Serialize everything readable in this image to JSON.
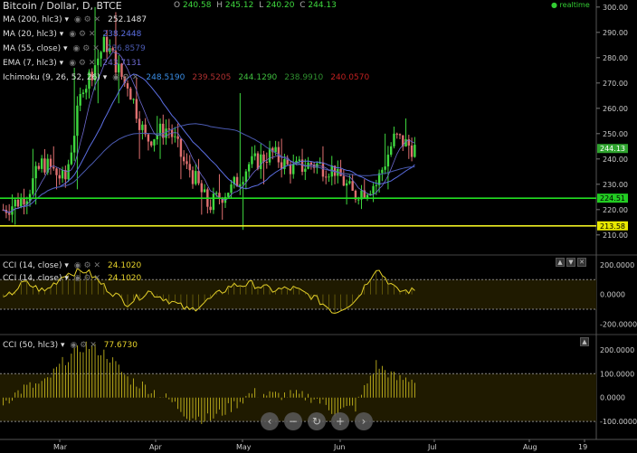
{
  "header": {
    "title": "Bitcoin / Dollar, D, BTCE",
    "ohlc": [
      {
        "k": "O",
        "v": "240.58"
      },
      {
        "k": "H",
        "v": "245.12"
      },
      {
        "k": "L",
        "v": "240.20"
      },
      {
        "k": "C",
        "v": "244.13"
      }
    ],
    "realtime_label": "realtime"
  },
  "studies": [
    {
      "name": "MA (200, hlc3)",
      "value": "252.1487",
      "color": "#e0e0e0"
    },
    {
      "name": "MA (20, hlc3)",
      "value": "238.2448",
      "color": "#5b6ee1"
    },
    {
      "name": "MA (55, close)",
      "value": "236.8579",
      "color": "#4a5ab0"
    },
    {
      "name": "EMA (7, hlc3)",
      "value": "243.7131",
      "color": "#6e6ad0"
    },
    {
      "name": "Ichimoku (9, 26, 52, 26)",
      "values": [
        {
          "v": "248.5190",
          "c": "#3a8ee6"
        },
        {
          "v": "239.5205",
          "c": "#b03030"
        },
        {
          "v": "244.1290",
          "c": "#3fbf3f"
        },
        {
          "v": "238.9910",
          "c": "#2f8f2f"
        },
        {
          "v": "240.0570",
          "c": "#c02020"
        }
      ]
    }
  ],
  "price_axis": {
    "ticks": [
      "300.00",
      "290.00",
      "280.00",
      "270.00",
      "260.00",
      "250.00",
      "240.00",
      "230.00",
      "220.00",
      "210.00"
    ],
    "tags": [
      {
        "label": "244.13",
        "bg": "#2fa42f",
        "fg": "#fff"
      },
      {
        "label": "224.51",
        "bg": "#22cc22",
        "fg": "#000"
      },
      {
        "label": "213.58",
        "bg": "#e8e800",
        "fg": "#000"
      }
    ]
  },
  "hlines": [
    {
      "value": 224.51,
      "color": "#22dd22"
    },
    {
      "value": 213.58,
      "color": "#eeee22"
    }
  ],
  "time_axis": {
    "ticks": [
      "Mar",
      "Apr",
      "May",
      "Jun",
      "Jul",
      "Aug",
      "19"
    ]
  },
  "pane2": {
    "legend": [
      {
        "name": "CCI (14, close)",
        "value": "24.1020"
      },
      {
        "name": "CCI (14, close)",
        "value": "24.1020"
      }
    ],
    "axis_ticks": [
      "200.0000",
      "0.0000",
      "-200.0000"
    ]
  },
  "pane3": {
    "legend": [
      {
        "name": "CCI (50, hlc3)",
        "value": "77.6730"
      }
    ],
    "axis_ticks": [
      "200.0000",
      "100.0000",
      "0.0000",
      "-100.0000"
    ]
  },
  "controls": {
    "nav": [
      "prev",
      "zoom-out",
      "reset",
      "zoom-in",
      "next"
    ]
  },
  "chart_data": {
    "type": "candlestick",
    "symbol": "Bitcoin / Dollar, D, BTCE",
    "ylim": [
      206,
      301
    ],
    "x_range": [
      "Feb 10",
      "Aug 26"
    ],
    "candles_weekly_approx": [
      {
        "date": "Feb 10",
        "o": 220,
        "h": 226,
        "l": 214,
        "c": 224
      },
      {
        "date": "Feb 17",
        "o": 224,
        "h": 244,
        "l": 222,
        "c": 238
      },
      {
        "date": "Feb 24",
        "o": 238,
        "h": 245,
        "l": 228,
        "c": 232
      },
      {
        "date": "Mar 3",
        "o": 232,
        "h": 276,
        "l": 228,
        "c": 270
      },
      {
        "date": "Mar 10",
        "o": 270,
        "h": 300,
        "l": 262,
        "c": 285
      },
      {
        "date": "Mar 17",
        "o": 285,
        "h": 298,
        "l": 262,
        "c": 270
      },
      {
        "date": "Mar 24",
        "o": 270,
        "h": 272,
        "l": 240,
        "c": 248
      },
      {
        "date": "Mar 31",
        "o": 248,
        "h": 257,
        "l": 240,
        "c": 252
      },
      {
        "date": "Apr 7",
        "o": 252,
        "h": 254,
        "l": 232,
        "c": 236
      },
      {
        "date": "Apr 14",
        "o": 236,
        "h": 240,
        "l": 218,
        "c": 222
      },
      {
        "date": "Apr 21",
        "o": 222,
        "h": 234,
        "l": 216,
        "c": 228
      },
      {
        "date": "Apr 28",
        "o": 228,
        "h": 266,
        "l": 212,
        "c": 238
      },
      {
        "date": "May 5",
        "o": 238,
        "h": 246,
        "l": 230,
        "c": 242
      },
      {
        "date": "May 12",
        "o": 242,
        "h": 248,
        "l": 234,
        "c": 236
      },
      {
        "date": "May 19",
        "o": 236,
        "h": 244,
        "l": 232,
        "c": 238
      },
      {
        "date": "May 26",
        "o": 238,
        "h": 245,
        "l": 230,
        "c": 236
      },
      {
        "date": "Jun 2",
        "o": 236,
        "h": 236,
        "l": 222,
        "c": 226
      },
      {
        "date": "Jun 9",
        "o": 226,
        "h": 232,
        "l": 224,
        "c": 230
      },
      {
        "date": "Jun 16",
        "o": 230,
        "h": 250,
        "l": 228,
        "c": 248
      },
      {
        "date": "Jun 23",
        "o": 248,
        "h": 256,
        "l": 240,
        "c": 244
      }
    ],
    "cci14_weekly_approx": [
      -40,
      80,
      20,
      140,
      160,
      40,
      -60,
      20,
      -40,
      -110,
      -30,
      60,
      70,
      30,
      40,
      -20,
      -120,
      -40,
      180,
      24
    ],
    "cci50_weekly_approx": [
      -20,
      40,
      60,
      160,
      220,
      180,
      80,
      40,
      -10,
      -80,
      -90,
      -40,
      20,
      10,
      10,
      0,
      -60,
      -40,
      140,
      78
    ]
  }
}
